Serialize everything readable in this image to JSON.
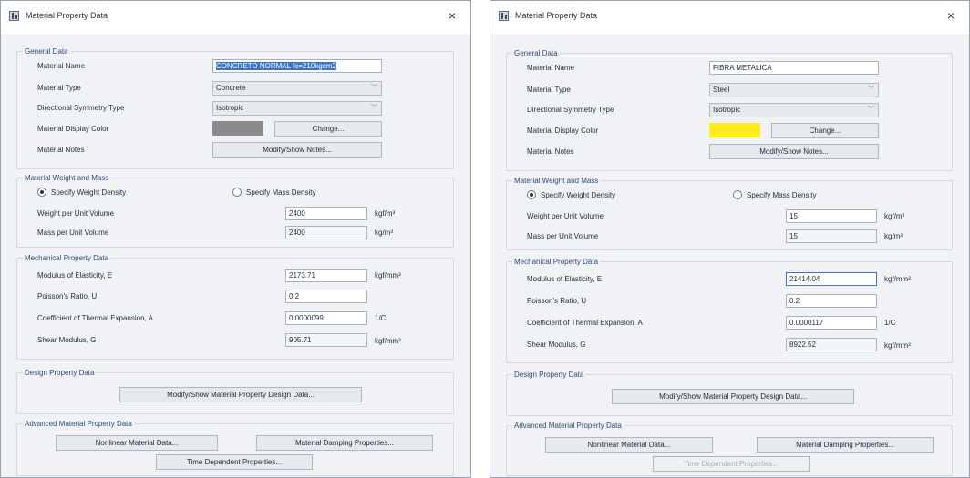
{
  "left": {
    "title": "Material Property Data",
    "close": "×",
    "general": {
      "title": "General Data",
      "name_label": "Material Name",
      "name_value": "CONCRETO NORMAL fc=210kgcm2",
      "type_label": "Material Type",
      "type_value": "Concrete",
      "symmetry_label": "Directional Symmetry Type",
      "symmetry_value": "Isotropic",
      "color_label": "Material Display Color",
      "color": "#8a8a8a",
      "change_btn": "Change...",
      "notes_label": "Material Notes",
      "notes_btn": "Modify/Show Notes..."
    },
    "weight": {
      "title": "Material Weight and Mass",
      "radio_weight": "Specify Weight Density",
      "radio_mass": "Specify Mass Density",
      "selected": "weight",
      "wpuv_label": "Weight per Unit Volume",
      "wpuv_value": "2400",
      "wpuv_unit": "kgf/m³",
      "mpuv_label": "Mass per Unit Volume",
      "mpuv_value": "2400",
      "mpuv_unit": "kg/m³"
    },
    "mech": {
      "title": "Mechanical Property Data",
      "e_label": "Modulus of Elasticity,  E",
      "e_value": "2173.71",
      "e_unit": "kgf/mm²",
      "u_label": "Poisson's Ratio,  U",
      "u_value": "0.2",
      "a_label": "Coefficient of Thermal Expansion,  A",
      "a_value": "0.0000099",
      "a_unit": "1/C",
      "g_label": "Shear Modulus,  G",
      "g_value": "905.71",
      "g_unit": "kgf/mm²"
    },
    "design": {
      "title": "Design Property Data",
      "btn": "Modify/Show Material Property Design Data..."
    },
    "advanced": {
      "title": "Advanced Material Property Data",
      "nonlinear_btn": "Nonlinear Material Data...",
      "damping_btn": "Material Damping Properties...",
      "time_btn": "Time Dependent Properties..."
    }
  },
  "right": {
    "title": "Material Property Data",
    "close": "×",
    "general": {
      "title": "General Data",
      "name_label": "Material Name",
      "name_value": "FIBRA METALICA",
      "type_label": "Material Type",
      "type_value": "Steel",
      "symmetry_label": "Directional Symmetry Type",
      "symmetry_value": "Isotropic",
      "color_label": "Material Display Color",
      "color": "#ffee1a",
      "change_btn": "Change...",
      "notes_label": "Material Notes",
      "notes_btn": "Modify/Show Notes..."
    },
    "weight": {
      "title": "Material Weight and Mass",
      "radio_weight": "Specify Weight Density",
      "radio_mass": "Specify Mass Density",
      "selected": "weight",
      "wpuv_label": "Weight per Unit Volume",
      "wpuv_value": "15",
      "wpuv_unit": "kgf/m³",
      "mpuv_label": "Mass per Unit Volume",
      "mpuv_value": "15",
      "mpuv_unit": "kg/m³"
    },
    "mech": {
      "title": "Mechanical Property Data",
      "e_label": "Modulus of Elasticity,  E",
      "e_value": "21414.04",
      "e_unit": "kgf/mm²",
      "u_label": "Poisson's Ratio,  U",
      "u_value": "0.2",
      "a_label": "Coefficient of Thermal Expansion,  A",
      "a_value": "0.0000117",
      "a_unit": "1/C",
      "g_label": "Shear Modulus,  G",
      "g_value": "8922.52",
      "g_unit": "kgf/mm²"
    },
    "design": {
      "title": "Design Property Data",
      "btn": "Modify/Show Material Property Design Data..."
    },
    "advanced": {
      "title": "Advanced Material Property Data",
      "nonlinear_btn": "Nonlinear Material Data...",
      "damping_btn": "Material Damping Properties...",
      "time_btn": "Time Dependent Properties..."
    }
  }
}
